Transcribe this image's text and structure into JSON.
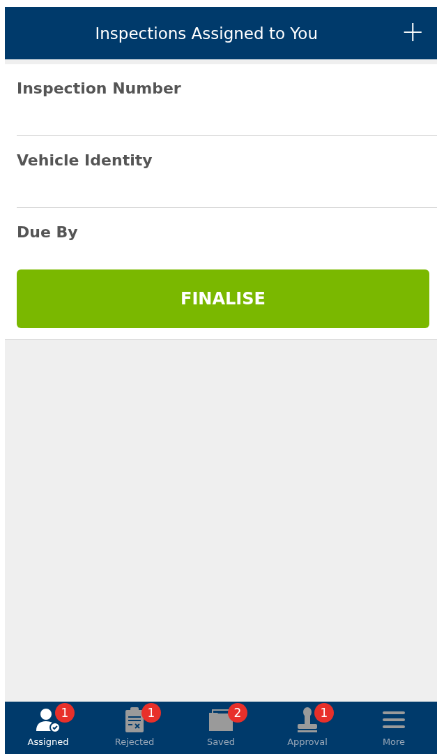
{
  "header": {
    "title": "Inspections Assigned to You",
    "add_button": "+"
  },
  "fields": [
    {
      "label": "Inspection Number"
    },
    {
      "label": "Vehicle Identity"
    },
    {
      "label": "Due By"
    }
  ],
  "finalise_button": "FINALISE",
  "tabs": [
    {
      "label": "Assigned",
      "kind": "person",
      "badge": "1",
      "selected": true
    },
    {
      "label": "Rejected",
      "kind": "clipboard",
      "badge": "1",
      "selected": false
    },
    {
      "label": "Saved",
      "kind": "folder",
      "badge": "2",
      "selected": false
    },
    {
      "label": "Approval",
      "kind": "stamp",
      "badge": "1",
      "selected": false
    },
    {
      "label": "More",
      "kind": "menu",
      "selected": false
    }
  ]
}
